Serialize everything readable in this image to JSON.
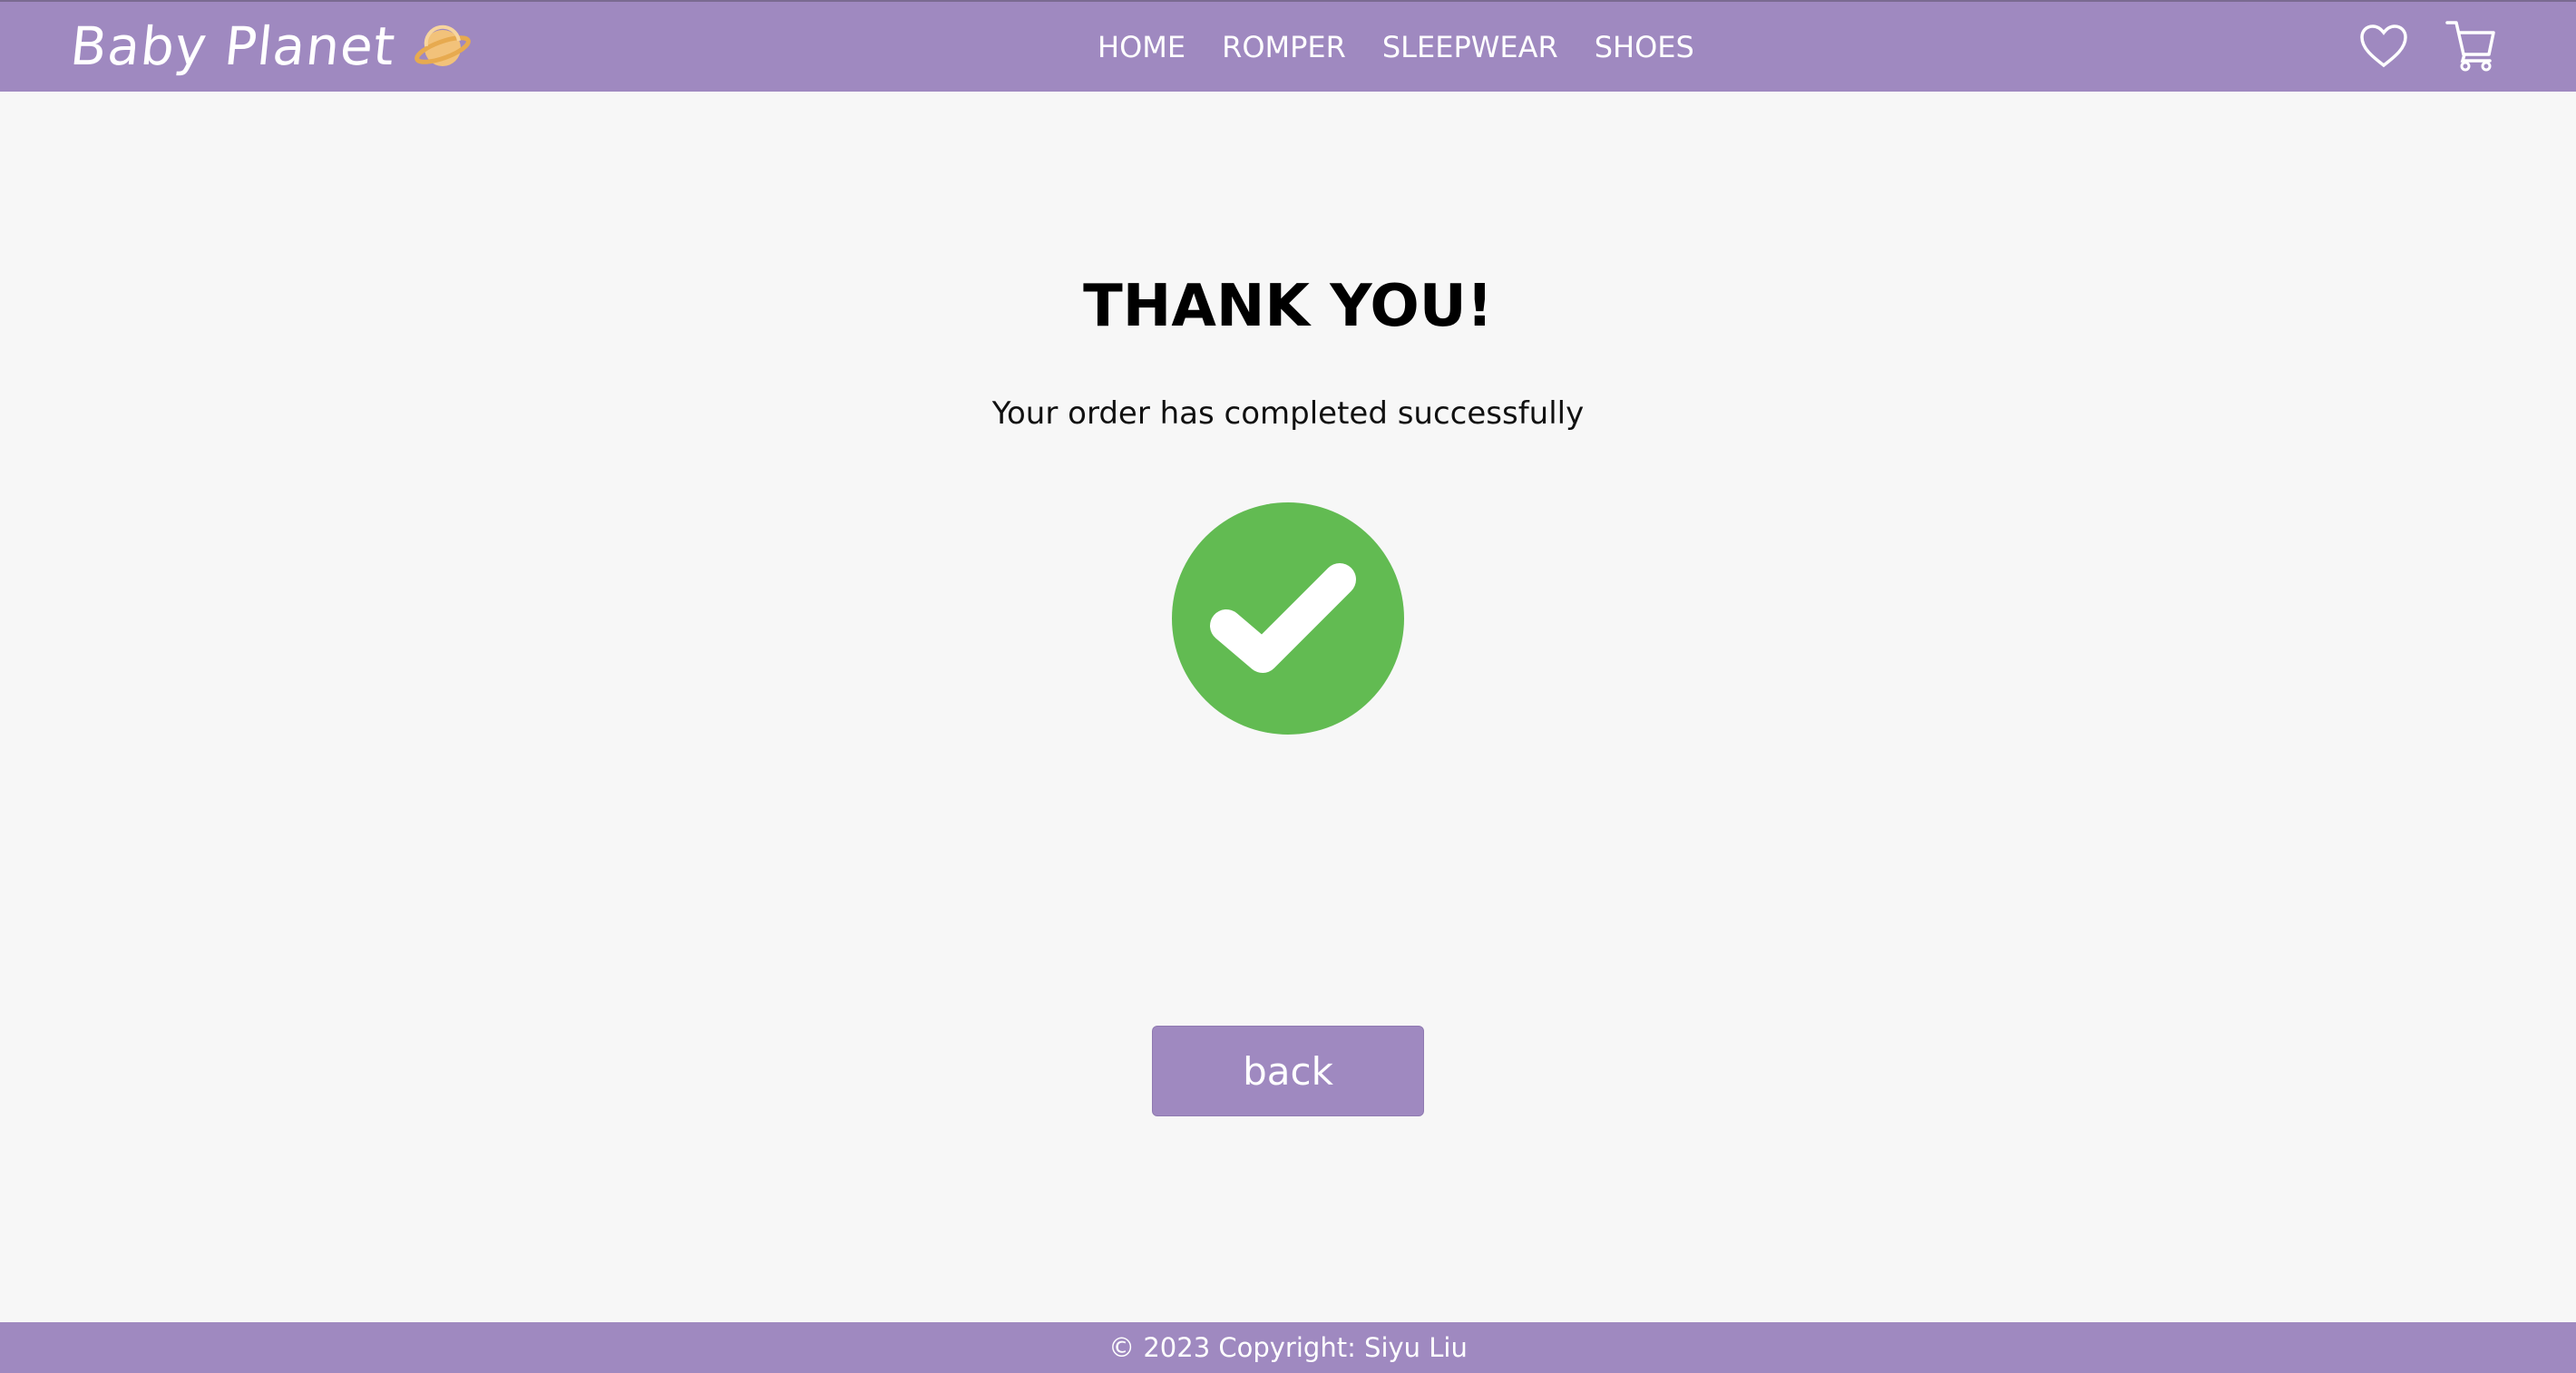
{
  "header": {
    "brand": "Baby Planet",
    "nav": [
      "HOME",
      "ROMPER",
      "SLEEPWEAR",
      "SHOES"
    ]
  },
  "main": {
    "title": "THANK YOU!",
    "message": "Your order has completed successfully",
    "back_label": "back"
  },
  "footer": {
    "text": "© 2023 Copyright: Siyu Liu"
  },
  "colors": {
    "header_bg": "#9f89c0",
    "success_green": "#62bb52",
    "page_bg": "#f7f7f7"
  },
  "icons": [
    "planet-icon",
    "heart-icon",
    "cart-icon",
    "checkmark-icon"
  ]
}
